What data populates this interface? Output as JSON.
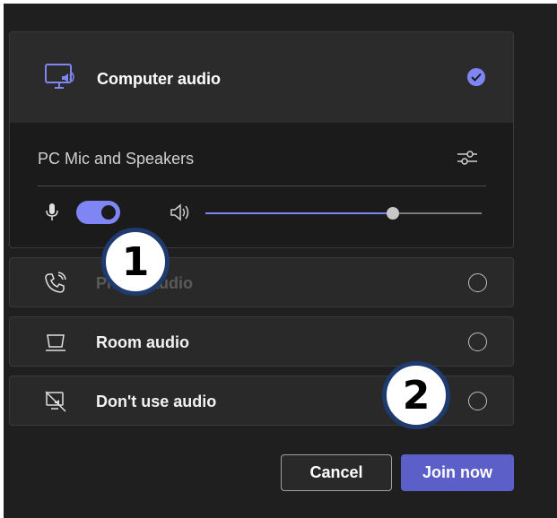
{
  "audio_options": {
    "computer": {
      "label": "Computer audio",
      "icon": "computer-speaker-icon",
      "selected": true
    },
    "device": {
      "label": "PC Mic and Speakers",
      "settings_icon": "sliders-icon"
    },
    "mic": {
      "icon": "microphone-icon",
      "enabled": true
    },
    "speaker": {
      "icon": "speaker-icon",
      "volume_percent": 68
    },
    "phone": {
      "label": "Phone audio",
      "icon": "phone-call-icon",
      "selected": false
    },
    "room": {
      "label": "Room audio",
      "icon": "room-display-icon",
      "selected": false
    },
    "none": {
      "label": "Don't use audio",
      "icon": "no-audio-icon",
      "selected": false
    }
  },
  "buttons": {
    "cancel": "Cancel",
    "join": "Join now"
  },
  "annotations": {
    "first": "1",
    "second": "2"
  },
  "colors": {
    "accent": "#7f85f5",
    "primary_button": "#5b5fc7",
    "badge_border": "#1f3a6e"
  }
}
